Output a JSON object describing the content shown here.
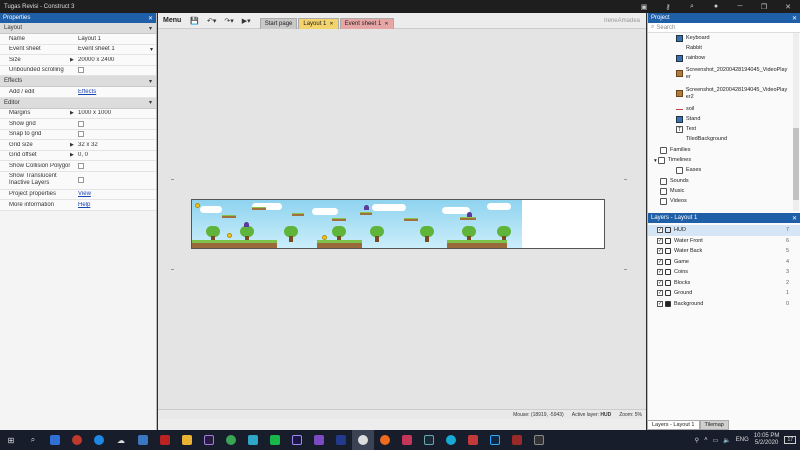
{
  "window": {
    "title": "Tugas Revisi - Construct 3"
  },
  "properties": {
    "header": "Properties",
    "sections": [
      {
        "name": "Layout",
        "rows": [
          {
            "key": "Name",
            "value": "Layout 1"
          },
          {
            "key": "Event sheet",
            "value": "Event sheet 1",
            "dropdown": true
          },
          {
            "key": "Size",
            "value": "20000 x 2400",
            "expand": true
          },
          {
            "key": "Unbounded scrolling",
            "checkbox": true
          }
        ]
      },
      {
        "name": "Effects",
        "rows": [
          {
            "key": "Add / edit",
            "link": "Effects"
          }
        ]
      },
      {
        "name": "Editor",
        "rows": [
          {
            "key": "Margins",
            "value": "1000 x 1000",
            "expand": true
          },
          {
            "key": "Show grid",
            "checkbox": true
          },
          {
            "key": "Snap to grid",
            "checkbox": true
          },
          {
            "key": "Grid size",
            "value": "32 x 32",
            "expand": true
          },
          {
            "key": "Grid offset",
            "value": "0, 0",
            "expand": true
          },
          {
            "key": "Show Collision Polygons",
            "checkbox": true
          },
          {
            "key": "Show Translucent Inactive Layers",
            "checkbox": true,
            "tall": true
          },
          {
            "key": "Project properties",
            "link": "View"
          },
          {
            "key": "More information",
            "link": "Help"
          }
        ]
      }
    ]
  },
  "toolbar": {
    "menu_label": "Menu",
    "tabs": [
      {
        "label": "Start page",
        "kind": "start"
      },
      {
        "label": "Layout 1",
        "kind": "layout"
      },
      {
        "label": "Event sheet 1",
        "kind": "event"
      }
    ],
    "user": "IreneAmadea"
  },
  "status": {
    "mouse_label": "Mouse:",
    "mouse_value": "(18919, -5943)",
    "layer_label": "Active layer:",
    "layer_value": "HUD",
    "zoom_label": "Zoom:",
    "zoom_value": "5%"
  },
  "project": {
    "header": "Project",
    "search_placeholder": "Search",
    "items": [
      {
        "label": "Keyboard",
        "icon": "keyboard-icon",
        "indent": 2
      },
      {
        "label": "Rabbit",
        "icon": "",
        "indent": 2
      },
      {
        "label": "rainbow",
        "icon": "rainbow-icon",
        "indent": 2
      },
      {
        "label": "Screenshot_20200428194045_VideoPlayer",
        "icon": "film-icon",
        "indent": 2
      },
      {
        "label": "Screenshot_20200428194045_VideoPlayer2",
        "icon": "film-icon",
        "indent": 2
      },
      {
        "label": "soil",
        "icon": "line-icon",
        "indent": 2
      },
      {
        "label": "Stand",
        "icon": "sprite-icon",
        "indent": 2
      },
      {
        "label": "Text",
        "icon": "text-icon",
        "indent": 2
      },
      {
        "label": "TiledBackground",
        "icon": "",
        "indent": 2
      },
      {
        "label": "Families",
        "icon": "folder-icon",
        "indent": 1
      },
      {
        "label": "Timelines",
        "icon": "folder-icon",
        "indent": 1,
        "expanded": true
      },
      {
        "label": "Eases",
        "icon": "folder-icon",
        "indent": 2
      },
      {
        "label": "Sounds",
        "icon": "folder-icon",
        "indent": 1
      },
      {
        "label": "Music",
        "icon": "folder-icon",
        "indent": 1
      },
      {
        "label": "Videos",
        "icon": "folder-icon",
        "indent": 1
      }
    ]
  },
  "layers": {
    "header": "Layers - Layout 1",
    "items": [
      {
        "name": "HUD",
        "index": "7",
        "selected": true
      },
      {
        "name": "Water Front",
        "index": "6"
      },
      {
        "name": "Water Back",
        "index": "5"
      },
      {
        "name": "Game",
        "index": "4"
      },
      {
        "name": "Coins",
        "index": "3"
      },
      {
        "name": "Blocks",
        "index": "2"
      },
      {
        "name": "Ground",
        "index": "1"
      },
      {
        "name": "Background",
        "index": "0",
        "locked": true
      }
    ],
    "bottom_tabs": [
      "Layers - Layout 1",
      "Tilemap"
    ]
  },
  "taskbar": {
    "lang": "ENG",
    "time": "10:05 PM",
    "date": "5/2/2020",
    "notif_count": "17"
  }
}
